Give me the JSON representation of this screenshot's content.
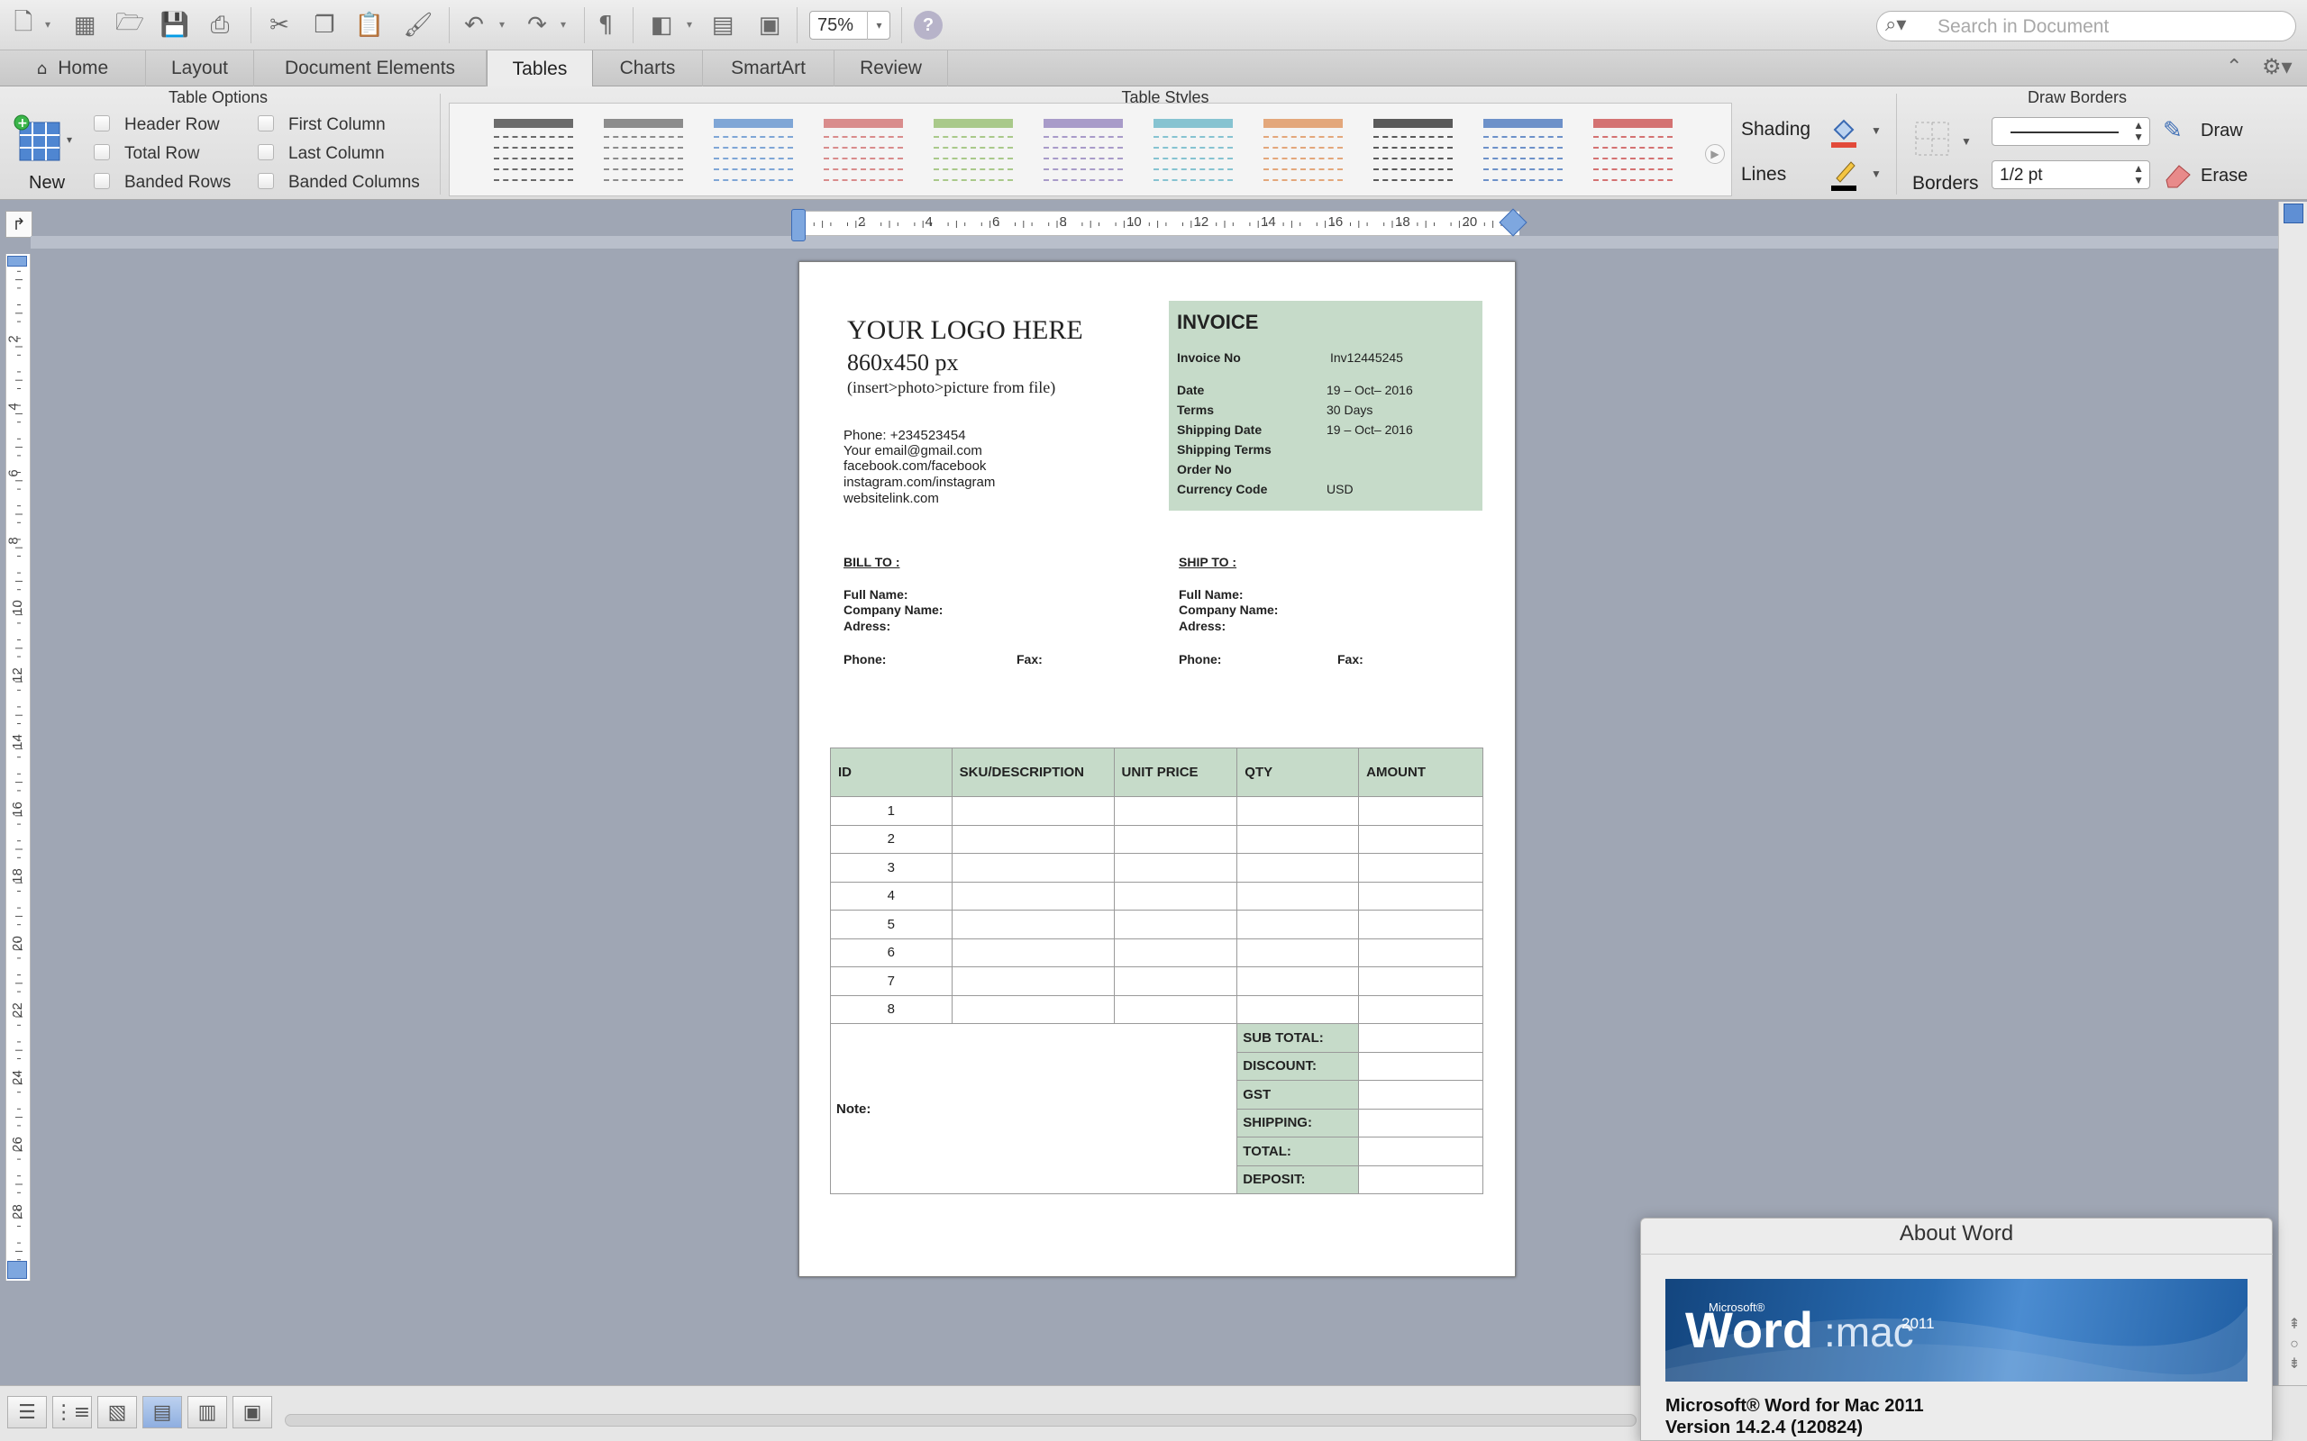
{
  "toolbar": {
    "zoom": "75%",
    "search_placeholder": "Search in Document",
    "icons": [
      "new-document-icon",
      "templates-icon",
      "open-icon",
      "save-icon",
      "print-icon",
      "cut-icon",
      "copy-icon",
      "paste-icon",
      "format-painter-icon",
      "undo-icon",
      "redo-icon",
      "pilcrow-icon",
      "sidebar-icon",
      "gallery-icon",
      "media-browser-icon",
      "help-icon"
    ]
  },
  "tabs": [
    "Home",
    "Layout",
    "Document Elements",
    "Tables",
    "Charts",
    "SmartArt",
    "Review"
  ],
  "active_tab": "Tables",
  "ribbon": {
    "table_options": {
      "title": "Table Options",
      "new_label": "New",
      "checks": [
        "Header Row",
        "Total Row",
        "Banded Rows",
        "First Column",
        "Last Column",
        "Banded Columns"
      ]
    },
    "table_styles": {
      "title": "Table Styles",
      "swatch_colors": [
        "#6b6b6b",
        "#8c8c8c",
        "#7fa6d6",
        "#d98c8c",
        "#a9c98a",
        "#a89bc9",
        "#86c3d1",
        "#e3a77b",
        "#5a5a5a",
        "#6d91c9",
        "#d47272"
      ]
    },
    "shading_label": "Shading",
    "lines_label": "Lines",
    "shading_color": "#e24a3a",
    "borders_label": "Borders",
    "draw_borders": {
      "title": "Draw Borders",
      "weight": "1/2 pt",
      "draw_label": "Draw",
      "erase_label": "Erase"
    }
  },
  "ruler": {
    "h_labels": [
      "2",
      "4",
      "6",
      "8",
      "10",
      "12",
      "14",
      "16",
      "18",
      "20"
    ],
    "v_labels": [
      "2",
      "4",
      "6",
      "8",
      "10",
      "12",
      "14",
      "16",
      "18",
      "20",
      "22",
      "24",
      "26",
      "28"
    ]
  },
  "document": {
    "logo_line1": "YOUR  LOGO HERE",
    "logo_line2": "860x450 px",
    "logo_line3": "(insert>photo>picture from file)",
    "contact": [
      "Phone: +234523454",
      "Your email@gmail.com",
      "facebook.com/facebook",
      "instagram.com/instagram",
      "websitelink.com"
    ],
    "invoice_title": "INVOICE",
    "invoice_rows": [
      {
        "label": "Invoice No",
        "value": "Inv12445245"
      },
      {
        "label": "Date",
        "value": "19 – Oct– 2016"
      },
      {
        "label": "Terms",
        "value": "30 Days"
      },
      {
        "label": "Shipping Date",
        "value": "19 – Oct– 2016"
      },
      {
        "label": "Shipping Terms",
        "value": ""
      },
      {
        "label": "Order No",
        "value": ""
      },
      {
        "label": "Currency Code",
        "value": "USD"
      }
    ],
    "bill_to": "BILL TO :",
    "ship_to": "SHIP TO :",
    "full_name": "Full Name:",
    "company_name": "Company Name:",
    "address": "Adress:",
    "phone": "Phone:",
    "fax": "Fax:",
    "table_headers": [
      "ID",
      "SKU/DESCRIPTION",
      "UNIT PRICE",
      "QTY",
      "AMOUNT"
    ],
    "item_ids": [
      "1",
      "2",
      "3",
      "4",
      "5",
      "6",
      "7",
      "8"
    ],
    "totals": [
      "SUB TOTAL:",
      "DISCOUNT:",
      "GST",
      "SHIPPING:",
      "TOTAL:",
      "DEPOSIT:"
    ],
    "note": "Note:",
    "accent_color": "#c6dbc9"
  },
  "about": {
    "title": "About Word",
    "banner_ms": "Microsoft®",
    "banner_word": "Word",
    "banner_mac": ":mac",
    "banner_year": "2011",
    "product_name": "Microsoft® Word for Mac 2011",
    "version": "Version 14.2.4 (120824)"
  }
}
